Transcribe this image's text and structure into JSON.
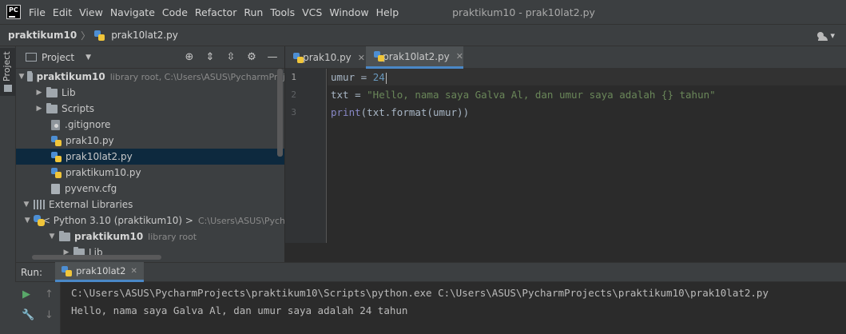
{
  "app": {
    "logo_text": "PC",
    "window_title": "praktikum10 - prak10lat2.py"
  },
  "menu": {
    "items": [
      "File",
      "Edit",
      "View",
      "Navigate",
      "Code",
      "Refactor",
      "Run",
      "Tools",
      "VCS",
      "Window",
      "Help"
    ]
  },
  "breadcrumb": {
    "project": "praktikum10",
    "file": "prak10lat2.py"
  },
  "project_panel": {
    "strip_label": "Project",
    "title": "Project",
    "tree": [
      {
        "label": "praktikum10",
        "detail": "library root,  C:\\Users\\ASUS\\PycharmProj"
      },
      {
        "label": "Lib"
      },
      {
        "label": "Scripts"
      },
      {
        "label": ".gitignore"
      },
      {
        "label": "prak10.py"
      },
      {
        "label": "prak10lat2.py"
      },
      {
        "label": "praktikum10.py"
      },
      {
        "label": "pyvenv.cfg"
      },
      {
        "label": "External Libraries"
      },
      {
        "label": "< Python 3.10 (praktikum10) >",
        "detail": "C:\\Users\\ASUS\\Pych"
      },
      {
        "label": "praktikum10",
        "detail": "library root"
      },
      {
        "label": "Lib"
      }
    ]
  },
  "editor": {
    "tabs": [
      {
        "label": "prak10.py"
      },
      {
        "label": "prak10lat2.py"
      }
    ],
    "line_numbers": [
      "1",
      "2",
      "3"
    ],
    "lines": [
      {
        "var": "umur",
        "op": " = ",
        "value": "24"
      },
      {
        "var": "txt",
        "op": " = ",
        "value": "\"Hello, nama saya Galva Al, dan umur saya adalah {} tahun\""
      },
      {
        "fn": "print",
        "rest": "(txt.format(umur))"
      }
    ]
  },
  "run_panel": {
    "label": "Run:",
    "tab_label": "prak10lat2",
    "output": [
      "C:\\Users\\ASUS\\PycharmProjects\\praktikum10\\Scripts\\python.exe C:\\Users\\ASUS\\PycharmProjects\\praktikum10\\prak10lat2.py",
      "Hello, nama saya Galva Al, dan umur saya adalah 24 tahun"
    ]
  },
  "colors": {
    "background": "#2b2b2b",
    "panel": "#3c3f41",
    "selection": "#0d293e",
    "accent": "#4a88c7",
    "number": "#6897bb",
    "string": "#6a8759",
    "builtin": "#8888c6"
  }
}
